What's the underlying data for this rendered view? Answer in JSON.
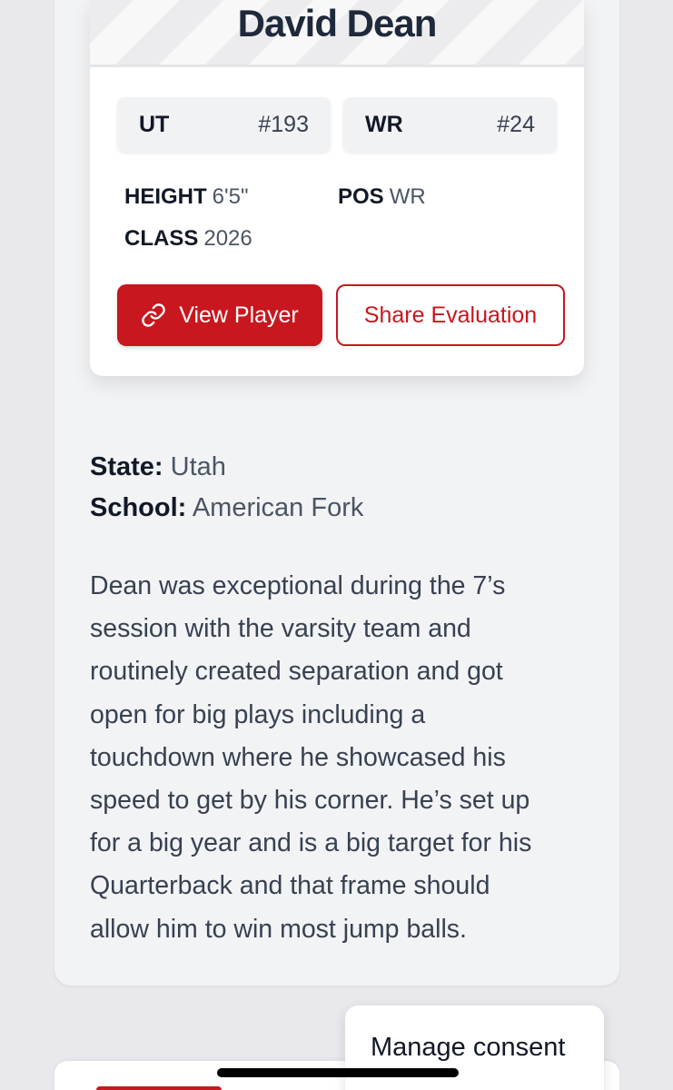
{
  "player": {
    "name": "David Dean",
    "state_rank": {
      "label": "UT",
      "value": "#193"
    },
    "position_rank": {
      "label": "WR",
      "value": "#24"
    },
    "height": {
      "label": "HEIGHT",
      "value": "6'5\""
    },
    "position": {
      "label": "POS",
      "value": "WR"
    },
    "class": {
      "label": "CLASS",
      "value": "2026"
    }
  },
  "actions": {
    "view_player": "View Player",
    "view_player_icon": "link-icon",
    "share_evaluation": "Share Evaluation"
  },
  "details": {
    "state_label": "State:",
    "state_value": "Utah",
    "school_label": "School:",
    "school_value": "American Fork"
  },
  "evaluation": {
    "lines": [
      "Dean was exceptional during the 7’s",
      "session with the varsity team and",
      "routinely created separation and got",
      "open for big plays including a",
      "touchdown where he showcased his",
      "speed to get by his corner. He’s set up",
      "for a big year and is a big target for his",
      "Quarterback and that frame should",
      "allow him to win most jump balls."
    ]
  },
  "consent": {
    "label": "Manage consent"
  },
  "colors": {
    "brand_red": "#c8171e",
    "page_bg": "#e9e9ed",
    "card_bg": "#f2f3f5"
  }
}
